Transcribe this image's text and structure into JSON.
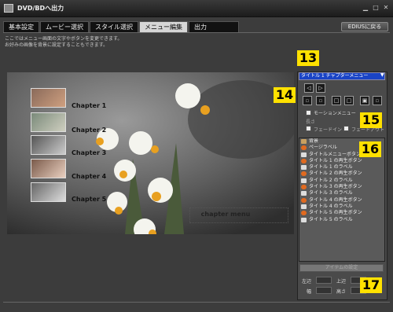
{
  "window": {
    "title": "DVD/BDへ出力",
    "min_icon": "minimize-icon",
    "max_icon": "maximize-icon",
    "close_icon": "close-icon"
  },
  "tabs": [
    {
      "label": "基本設定",
      "active": false
    },
    {
      "label": "ムービー選択",
      "active": false
    },
    {
      "label": "スタイル選択",
      "active": false
    },
    {
      "label": "メニュー編集",
      "active": true
    },
    {
      "label": "出力",
      "active": false
    }
  ],
  "back_button": "EDIUSに戻る",
  "description": {
    "line1": "ここではメニュー画面の文字やボタンを変更できます。",
    "line2": "お好みの画像を背景に設定することもできます。"
  },
  "preview": {
    "chapters": [
      "Chapter 1",
      "Chapter 2",
      "Chapter 3",
      "Chapter 4",
      "Chapter 5"
    ],
    "menu_text": "chapter menu"
  },
  "badges": {
    "b13": "13",
    "b14": "14",
    "b15": "15",
    "b16": "16",
    "b17": "17"
  },
  "panel": {
    "menu_select": "タイトル 1 チャプターメニュー",
    "motion_menu": "モーションメニュー",
    "length_label": "長さ",
    "fade_in": "フェードイン",
    "fade_out": "フェードアウト",
    "items": [
      {
        "label": "背景",
        "icon": "folder"
      },
      {
        "label": "ページラベル",
        "icon": "orange"
      },
      {
        "label": "タイトルメニューボタン",
        "icon": "white"
      },
      {
        "label": "タイトル 1 の再生ボタン",
        "icon": "orange"
      },
      {
        "label": "タイトル 1 のラベル",
        "icon": "white"
      },
      {
        "label": "タイトル 2 の再生ボタン",
        "icon": "orange"
      },
      {
        "label": "タイトル 2 のラベル",
        "icon": "white"
      },
      {
        "label": "タイトル 3 の再生ボタン",
        "icon": "orange"
      },
      {
        "label": "タイトル 3 のラベル",
        "icon": "white"
      },
      {
        "label": "タイトル 4 の再生ボタン",
        "icon": "orange"
      },
      {
        "label": "タイトル 4 のラベル",
        "icon": "white"
      },
      {
        "label": "タイトル 5 の再生ボタン",
        "icon": "orange"
      },
      {
        "label": "タイトル 5 のラベル",
        "icon": "white"
      }
    ],
    "apply_button": "アイテムの設定",
    "left": "左辺",
    "top": "上辺",
    "width": "幅",
    "height": "高さ"
  }
}
